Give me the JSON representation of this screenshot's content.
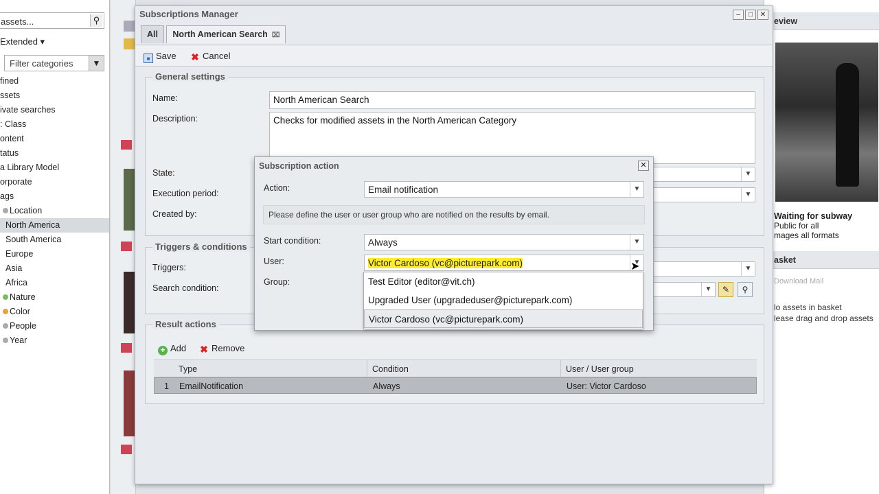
{
  "sidebar": {
    "search_text": "assets...",
    "search_icon": "search-icon",
    "mode": "Extended ▾",
    "filter_placeholder": "Filter categories",
    "categories": [
      "fined",
      "ssets",
      "ivate searches",
      ": Class",
      "ontent",
      "tatus",
      "a Library Model",
      "orporate",
      "ags",
      "Location",
      "North America",
      "South America",
      "Europe",
      "Asia",
      "Africa",
      "Nature",
      "Color",
      "People",
      "Year"
    ],
    "selected_category": "North America"
  },
  "window": {
    "title": "Subscriptions Manager",
    "tabs": [
      {
        "label": "All",
        "active": false
      },
      {
        "label": "North American Search",
        "active": true
      }
    ],
    "toolbar": {
      "save": "Save",
      "cancel": "Cancel"
    },
    "general": {
      "title": "General settings",
      "name_label": "Name:",
      "name_value": "North American Search",
      "description_label": "Description:",
      "description_value": "Checks for modified assets in the North American Category",
      "state_label": "State:",
      "execution_label": "Execution period:",
      "created_label": "Created by:"
    },
    "triggers": {
      "title": "Triggers & conditions",
      "triggers_label": "Triggers:",
      "search_label": "Search condition:"
    },
    "results": {
      "title": "Result actions",
      "add": "Add",
      "remove": "Remove",
      "columns": [
        "Type",
        "Condition",
        "User / User group"
      ],
      "rows": [
        {
          "index": "1",
          "type": "EmailNotification",
          "condition": "Always",
          "user": "User: Victor Cardoso"
        }
      ]
    }
  },
  "dialog": {
    "title": "Subscription action",
    "action_label": "Action:",
    "action_value": "Email notification",
    "note": "Please define the user or user group who are notified on the results by email.",
    "start_label": "Start condition:",
    "start_value": "Always",
    "user_label": "User:",
    "user_value": "Victor Cardoso (vc@picturepark.com)",
    "group_label": "Group:",
    "options": [
      "Test Editor (editor@vit.ch)",
      "Upgraded User (upgradeduser@picturepark.com)",
      "Victor Cardoso (vc@picturepark.com)"
    ]
  },
  "preview": {
    "header": "eview",
    "caption_title": "Waiting for subway",
    "caption_line1": "Public for all",
    "caption_line2": "mages all formats",
    "basket_header": "asket",
    "basket_buttons": "Download   Mail",
    "basket_empty1": "lo assets in basket",
    "basket_empty2": "lease drag and drop assets"
  },
  "colors": {
    "highlight": "#ffec2e",
    "accent": "#3a68a8"
  }
}
